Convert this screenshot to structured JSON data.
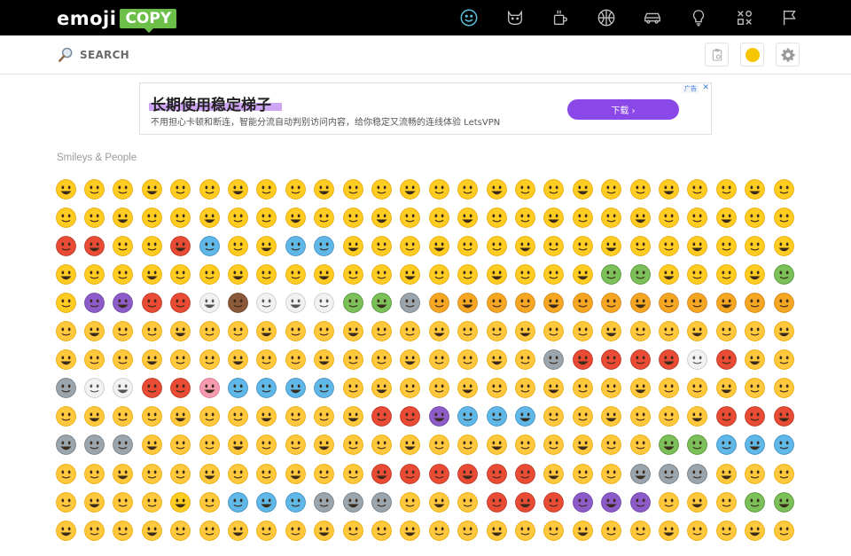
{
  "logo": {
    "part1": "emoji",
    "part2": "COPY"
  },
  "categories": [
    {
      "name": "smileys-people",
      "icon": "smiley-icon",
      "active": true
    },
    {
      "name": "animals-nature",
      "icon": "cat-icon",
      "active": false
    },
    {
      "name": "food-drink",
      "icon": "cup-icon",
      "active": false
    },
    {
      "name": "activities",
      "icon": "ball-icon",
      "active": false
    },
    {
      "name": "travel-places",
      "icon": "car-icon",
      "active": false
    },
    {
      "name": "objects",
      "icon": "bulb-icon",
      "active": false
    },
    {
      "name": "symbols",
      "icon": "symbols-icon",
      "active": false
    },
    {
      "name": "flags",
      "icon": "flag-icon",
      "active": false
    }
  ],
  "search": {
    "placeholder": "SEARCH",
    "value": ""
  },
  "tools": [
    {
      "name": "clipboard",
      "icon": "clipboard-icon"
    },
    {
      "name": "skin-tone",
      "icon": "skin-tone-icon",
      "color": "#f7c600"
    },
    {
      "name": "settings",
      "icon": "gear-icon"
    }
  ],
  "ad": {
    "title": "长期使用稳定梯子",
    "description": "不用担心卡顿和断连，智能分流自动判别访问内容，给你稳定又流畅的连线体验 LetsVPN",
    "button_label": "下载 ›",
    "badge": "广告",
    "close": "✕"
  },
  "section": {
    "title": "Smileys & People"
  },
  "colors": {
    "accent": "#5bc0de",
    "brand_green": "#6cc04a",
    "emoji_yellow": "#ffcc21",
    "ad_button": "#8a48e8"
  },
  "emoji_grid": {
    "columns": 26,
    "rows": [
      [
        "yellow",
        "yellow",
        "yellow",
        "yellow",
        "yellow",
        "yellow",
        "yellow",
        "yellow",
        "yellow",
        "yellow",
        "yellow",
        "yellow",
        "yellow",
        "yellow",
        "yellow",
        "yellow",
        "yellow",
        "yellow",
        "yellow",
        "yellow",
        "yellow",
        "yellow",
        "yellow",
        "yellow",
        "yellow",
        "yellow"
      ],
      [
        "yellow",
        "yellow",
        "yellow",
        "yellow",
        "yellow",
        "yellow",
        "yellow",
        "yellow",
        "yellow",
        "yellow",
        "yellow",
        "yellow",
        "yellow",
        "yellow",
        "yellow",
        "yellow",
        "yellow",
        "yellow",
        "yellow",
        "yellow",
        "yellow",
        "yellow",
        "yellow",
        "yellow",
        "yellow",
        "yellow"
      ],
      [
        "red",
        "red",
        "yellow",
        "yellow",
        "red",
        "blue",
        "yellow",
        "yellow",
        "blue",
        "blue",
        "yellow",
        "yellow",
        "yellow",
        "yellow",
        "yellow",
        "yellow",
        "yellow",
        "yellow",
        "yellow",
        "yellow",
        "yellow",
        "yellow",
        "yellow",
        "yellow",
        "yellow",
        "yellow"
      ],
      [
        "yellow",
        "yellow",
        "yellow",
        "yellow",
        "yellow",
        "yellow",
        "yellow",
        "yellow",
        "yellow",
        "yellow",
        "yellow",
        "yellow",
        "yellow",
        "yellow",
        "yellow",
        "yellow",
        "yellow",
        "yellow",
        "yellow",
        "green",
        "green",
        "yellow",
        "yellow",
        "yellow",
        "yellow",
        "green"
      ],
      [
        "yellow",
        "purple",
        "purple",
        "red",
        "red",
        "white",
        "brown",
        "white",
        "white",
        "white",
        "green",
        "green",
        "grey",
        "orange",
        "orange",
        "orange",
        "orange",
        "orange",
        "orange",
        "orange",
        "orange",
        "orange",
        "orange",
        "orange",
        "orange",
        "orange"
      ],
      [
        "skin",
        "skin",
        "skin",
        "skin",
        "skin",
        "skin",
        "skin",
        "skin",
        "skin",
        "skin",
        "skin",
        "skin",
        "skin",
        "skin",
        "skin",
        "skin",
        "skin",
        "skin",
        "skin",
        "skin",
        "skin",
        "skin",
        "skin",
        "skin",
        "skin",
        "skin"
      ],
      [
        "skin",
        "skin",
        "skin",
        "skin",
        "skin",
        "skin",
        "skin",
        "skin",
        "skin",
        "skin",
        "skin",
        "skin",
        "skin",
        "skin",
        "skin",
        "skin",
        "skin",
        "grey",
        "red",
        "red",
        "red",
        "red",
        "white",
        "red",
        "skin",
        "skin"
      ],
      [
        "grey",
        "white",
        "white",
        "red",
        "red",
        "pink",
        "blue",
        "blue",
        "blue",
        "blue",
        "skin",
        "skin",
        "skin",
        "skin",
        "skin",
        "skin",
        "skin",
        "skin",
        "skin",
        "skin",
        "skin",
        "skin",
        "skin",
        "skin",
        "skin",
        "skin"
      ],
      [
        "skin",
        "skin",
        "skin",
        "skin",
        "skin",
        "skin",
        "skin",
        "skin",
        "skin",
        "skin",
        "skin",
        "red",
        "red",
        "purple",
        "blue",
        "blue",
        "blue",
        "skin",
        "skin",
        "skin",
        "skin",
        "skin",
        "skin",
        "red",
        "red",
        "red"
      ],
      [
        "grey",
        "grey",
        "grey",
        "skin",
        "skin",
        "skin",
        "skin",
        "skin",
        "skin",
        "skin",
        "skin",
        "skin",
        "skin",
        "skin",
        "skin",
        "skin",
        "skin",
        "skin",
        "skin",
        "skin",
        "skin",
        "green",
        "green",
        "blue",
        "blue",
        "blue"
      ],
      [
        "skin",
        "skin",
        "skin",
        "skin",
        "skin",
        "skin",
        "skin",
        "skin",
        "skin",
        "skin",
        "skin",
        "red",
        "red",
        "red",
        "red",
        "red",
        "red",
        "skin",
        "skin",
        "skin",
        "grey",
        "grey",
        "grey",
        "skin",
        "skin",
        "skin"
      ],
      [
        "skin",
        "skin",
        "skin",
        "skin",
        "yellow",
        "skin",
        "blue",
        "blue",
        "blue",
        "grey",
        "grey",
        "grey",
        "skin",
        "skin",
        "skin",
        "red",
        "red",
        "red",
        "purple",
        "purple",
        "purple",
        "skin",
        "skin",
        "skin",
        "green",
        "green"
      ],
      [
        "skin",
        "skin",
        "skin",
        "skin",
        "skin",
        "skin",
        "skin",
        "skin",
        "skin",
        "skin",
        "skin",
        "skin",
        "skin",
        "skin",
        "skin",
        "skin",
        "skin",
        "skin",
        "skin",
        "skin",
        "skin",
        "skin",
        "skin",
        "skin",
        "skin",
        "skin"
      ]
    ]
  }
}
